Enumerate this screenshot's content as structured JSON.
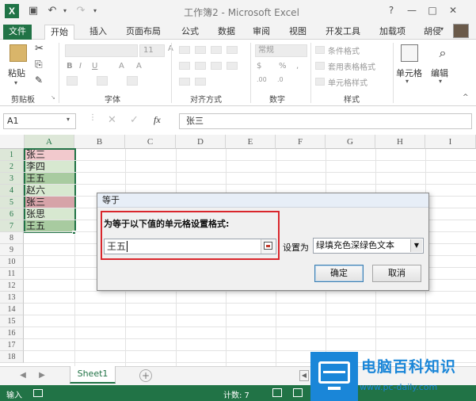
{
  "title_bar": {
    "app_icon_label": "X",
    "title": "工作簿2 - Microsoft Excel",
    "help": "?",
    "minimize": "—",
    "restore": "□",
    "close": "✕"
  },
  "tabs": [
    "文件",
    "开始",
    "插入",
    "页面布局",
    "公式",
    "数据",
    "审阅",
    "视图",
    "开发工具",
    "加载项"
  ],
  "user_name": "胡侵",
  "ribbon": {
    "clipboard": {
      "paste": "粘贴",
      "label": "剪贴板"
    },
    "font": {
      "label": "字体",
      "size": "11"
    },
    "alignment": {
      "label": "对齐方式"
    },
    "number": {
      "format": "常规",
      "label": "数字"
    },
    "styles": {
      "conditional": "条件格式",
      "table": "套用表格格式",
      "cell": "单元格样式",
      "label": "样式"
    },
    "cells": {
      "label": "单元格"
    },
    "editing": {
      "label": "编辑"
    }
  },
  "formula_bar": {
    "name_box": "A1",
    "fx": "fx",
    "content": "张三"
  },
  "columns": [
    "A",
    "B",
    "C",
    "D",
    "E",
    "F",
    "G",
    "H",
    "I"
  ],
  "rows": [
    "1",
    "2",
    "3",
    "4",
    "5",
    "6",
    "7",
    "8",
    "9",
    "10",
    "11",
    "12",
    "13",
    "14",
    "15",
    "16",
    "17",
    "18"
  ],
  "cells": [
    {
      "row": 1,
      "value": "张三",
      "fill": "#f2c9cd"
    },
    {
      "row": 2,
      "value": "李四",
      "fill": "#d7e8d0"
    },
    {
      "row": 3,
      "value": "王五",
      "fill": "#a8cba0"
    },
    {
      "row": 4,
      "value": "赵六",
      "fill": "#d7e8d0"
    },
    {
      "row": 5,
      "value": "张三",
      "fill": "#d6a3a8"
    },
    {
      "row": 6,
      "value": "张思",
      "fill": "#d7e8d0"
    },
    {
      "row": 7,
      "value": "王五",
      "fill": "#a8cba0"
    }
  ],
  "dialog": {
    "title": "等于",
    "prompt": "为等于以下值的单元格设置格式:",
    "input_value": "王五",
    "set_as_label": "设置为",
    "format_option": "绿填充色深绿色文本",
    "ok": "确定",
    "cancel": "取消"
  },
  "sheet_tabs": {
    "active": "Sheet1",
    "add": "+"
  },
  "status_bar": {
    "mode": "输入",
    "count": "计数: 7"
  },
  "watermark": {
    "title": "电脑百科知识",
    "url": "www.pc-daily.com"
  },
  "colors": {
    "excel_green": "#217346",
    "highlight_red": "#d9262c",
    "watermark_blue": "#1a86d8"
  }
}
